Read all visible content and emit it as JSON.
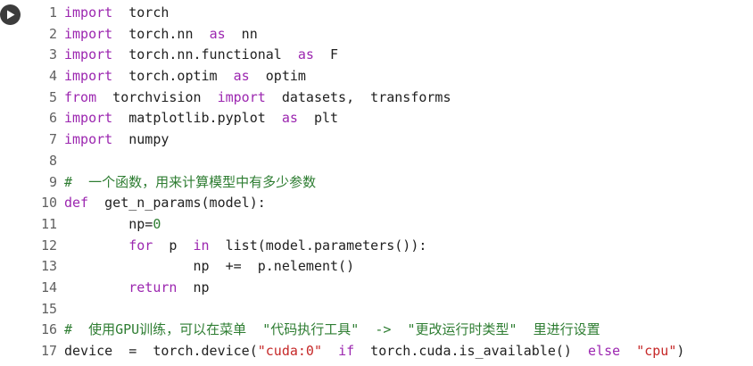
{
  "run_button": {
    "icon": "play-icon"
  },
  "lines": [
    {
      "n": "1",
      "tokens": [
        {
          "t": "import",
          "c": "kw"
        },
        {
          "t": "  torch"
        }
      ]
    },
    {
      "n": "2",
      "tokens": [
        {
          "t": "import",
          "c": "kw"
        },
        {
          "t": "  torch.nn  "
        },
        {
          "t": "as",
          "c": "kw"
        },
        {
          "t": "  nn"
        }
      ]
    },
    {
      "n": "3",
      "tokens": [
        {
          "t": "import",
          "c": "kw"
        },
        {
          "t": "  torch.nn.functional  "
        },
        {
          "t": "as",
          "c": "kw"
        },
        {
          "t": "  F"
        }
      ]
    },
    {
      "n": "4",
      "tokens": [
        {
          "t": "import",
          "c": "kw"
        },
        {
          "t": "  torch.optim  "
        },
        {
          "t": "as",
          "c": "kw"
        },
        {
          "t": "  optim"
        }
      ]
    },
    {
      "n": "5",
      "tokens": [
        {
          "t": "from",
          "c": "kw"
        },
        {
          "t": "  torchvision  "
        },
        {
          "t": "import",
          "c": "kw"
        },
        {
          "t": "  datasets,  transforms"
        }
      ]
    },
    {
      "n": "6",
      "tokens": [
        {
          "t": "import",
          "c": "kw"
        },
        {
          "t": "  matplotlib.pyplot  "
        },
        {
          "t": "as",
          "c": "kw"
        },
        {
          "t": "  plt"
        }
      ]
    },
    {
      "n": "7",
      "tokens": [
        {
          "t": "import",
          "c": "kw"
        },
        {
          "t": "  numpy"
        }
      ]
    },
    {
      "n": "8",
      "tokens": []
    },
    {
      "n": "9",
      "tokens": [
        {
          "t": "#  一个函数，用来计算模型中有多少参数",
          "c": "cmt"
        }
      ]
    },
    {
      "n": "10",
      "tokens": [
        {
          "t": "def",
          "c": "kw"
        },
        {
          "t": "  get_n_params(model):"
        }
      ]
    },
    {
      "n": "11",
      "tokens": [
        {
          "t": "        np="
        },
        {
          "t": "0",
          "c": "num"
        }
      ]
    },
    {
      "n": "12",
      "tokens": [
        {
          "t": "        "
        },
        {
          "t": "for",
          "c": "kw"
        },
        {
          "t": "  p  "
        },
        {
          "t": "in",
          "c": "kw"
        },
        {
          "t": "  list(model.parameters()):"
        }
      ]
    },
    {
      "n": "13",
      "tokens": [
        {
          "t": "                np  +=  p.nelement()"
        }
      ]
    },
    {
      "n": "14",
      "tokens": [
        {
          "t": "        "
        },
        {
          "t": "return",
          "c": "kw"
        },
        {
          "t": "  np"
        }
      ]
    },
    {
      "n": "15",
      "tokens": []
    },
    {
      "n": "16",
      "tokens": [
        {
          "t": "#  使用GPU训练，可以在菜单  \"代码执行工具\"  ->  \"更改运行时类型\"  里进行设置",
          "c": "cmt"
        }
      ]
    },
    {
      "n": "17",
      "tokens": [
        {
          "t": "device  =  torch.device("
        },
        {
          "t": "\"cuda:0\"",
          "c": "str"
        },
        {
          "t": "  "
        },
        {
          "t": "if",
          "c": "kw"
        },
        {
          "t": "  torch.cuda.is_available()  "
        },
        {
          "t": "else",
          "c": "kw"
        },
        {
          "t": "  "
        },
        {
          "t": "\"cpu\"",
          "c": "str"
        },
        {
          "t": ")"
        }
      ]
    }
  ]
}
